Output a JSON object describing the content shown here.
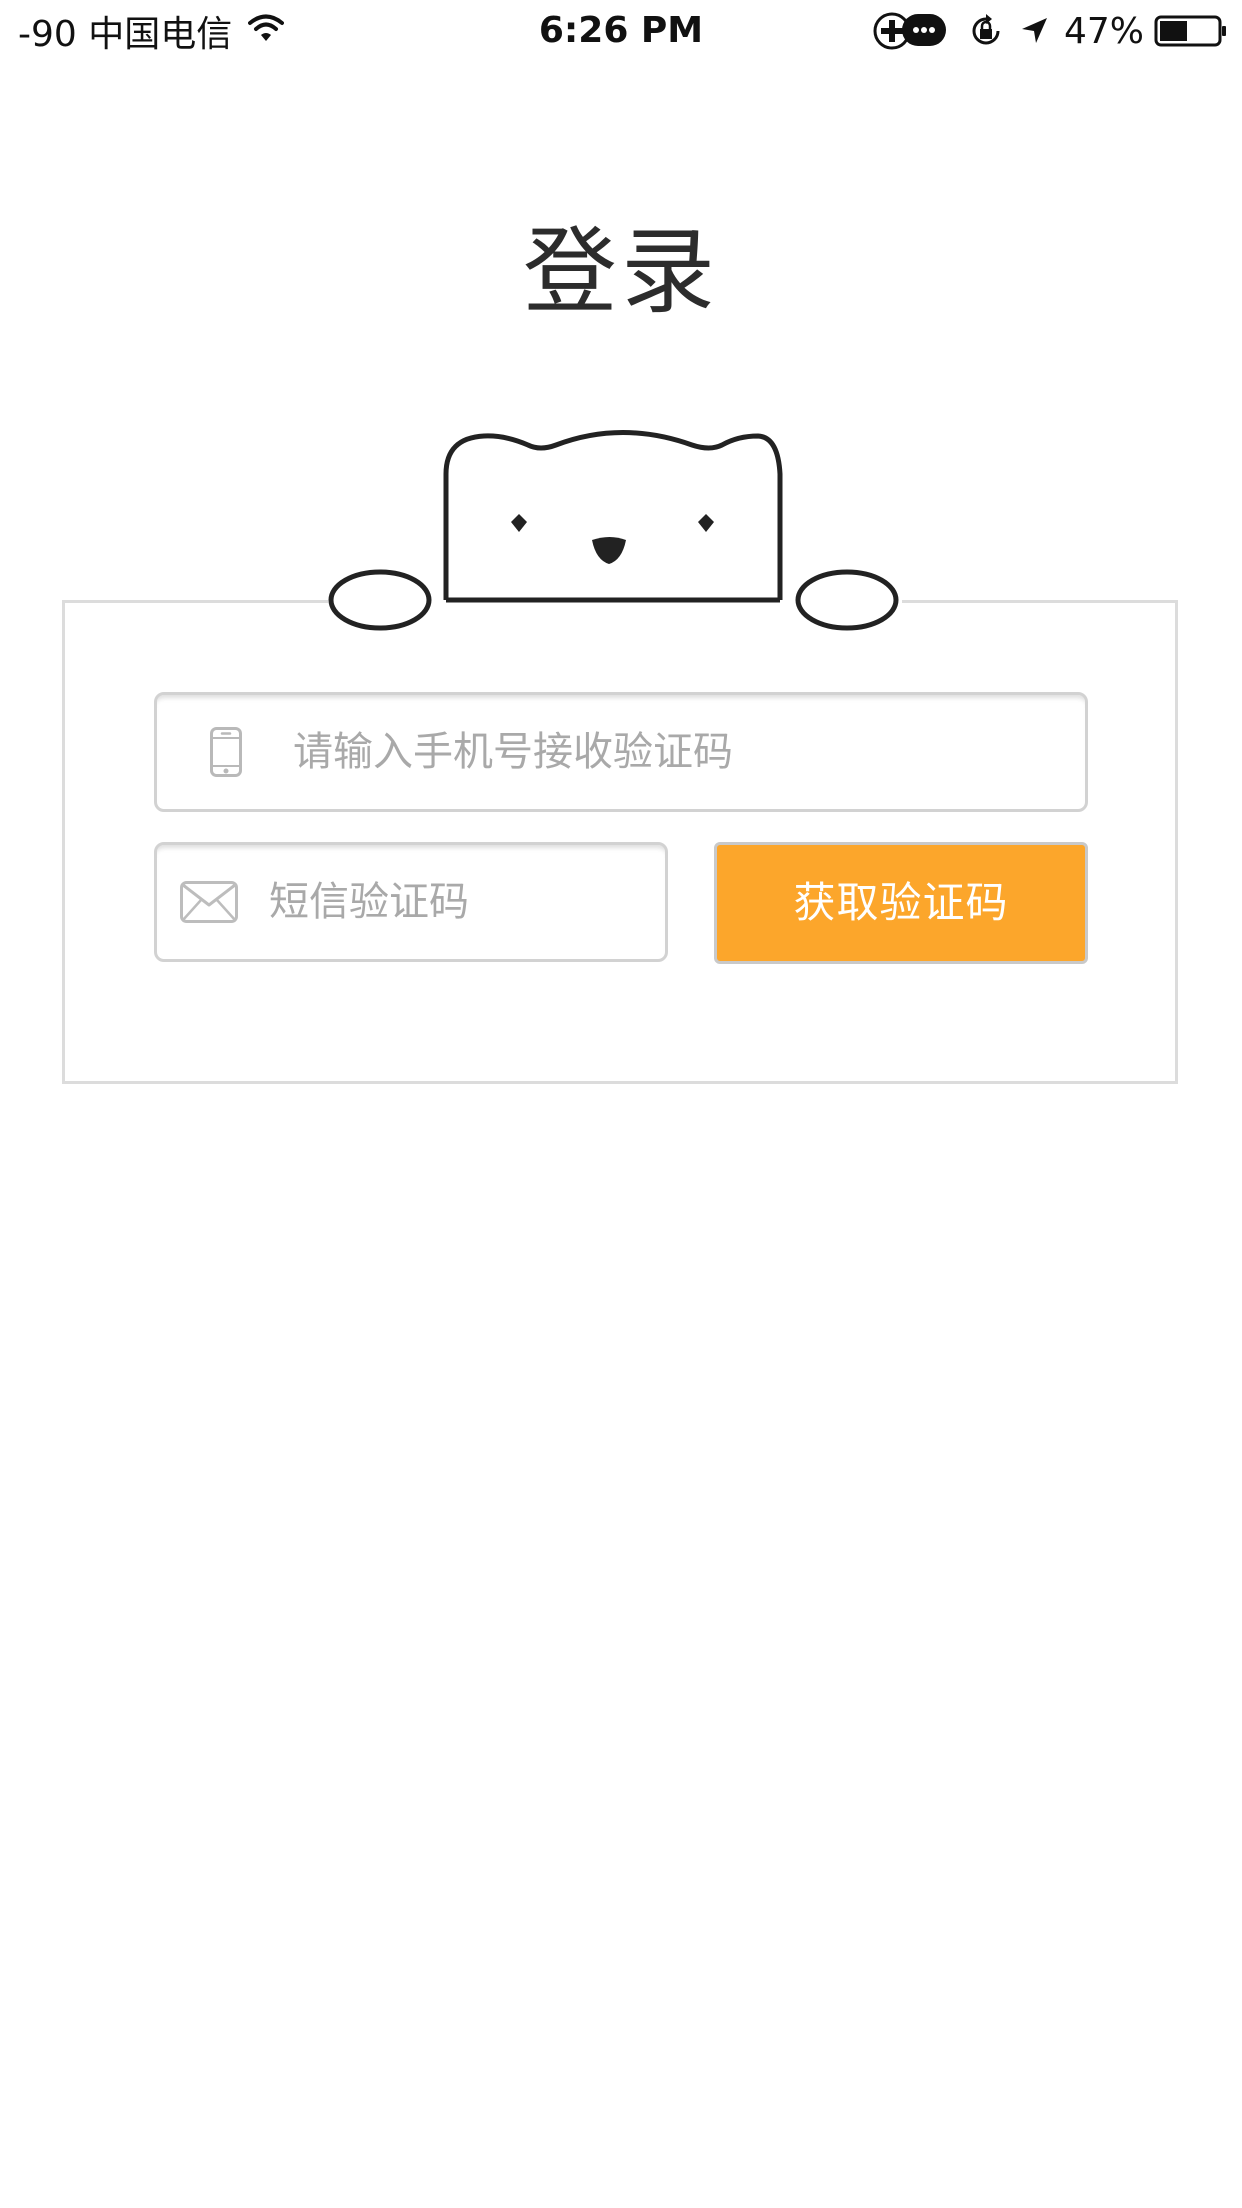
{
  "status_bar": {
    "carrier": "-90 中国电信",
    "time": "6:26 PM",
    "battery_percent": "47%",
    "battery_level": 0.47,
    "icons": [
      "wifi-icon",
      "plus-circle-icon",
      "message-bubble-icon",
      "rotation-lock-icon",
      "location-arrow-icon",
      "battery-icon"
    ]
  },
  "page": {
    "title": "登录"
  },
  "login_form": {
    "phone": {
      "placeholder": "请输入手机号接收验证码",
      "value": "",
      "icon": "phone-icon"
    },
    "code": {
      "placeholder": "短信验证码",
      "value": "",
      "icon": "envelope-icon"
    },
    "get_code_button": {
      "label": "获取验证码"
    }
  },
  "colors": {
    "accent": "#fca62b",
    "border": "#d2d2d2",
    "card_border": "#dcdcdc",
    "text_dark": "#2c2c2c",
    "placeholder": "#a9a9a9"
  }
}
